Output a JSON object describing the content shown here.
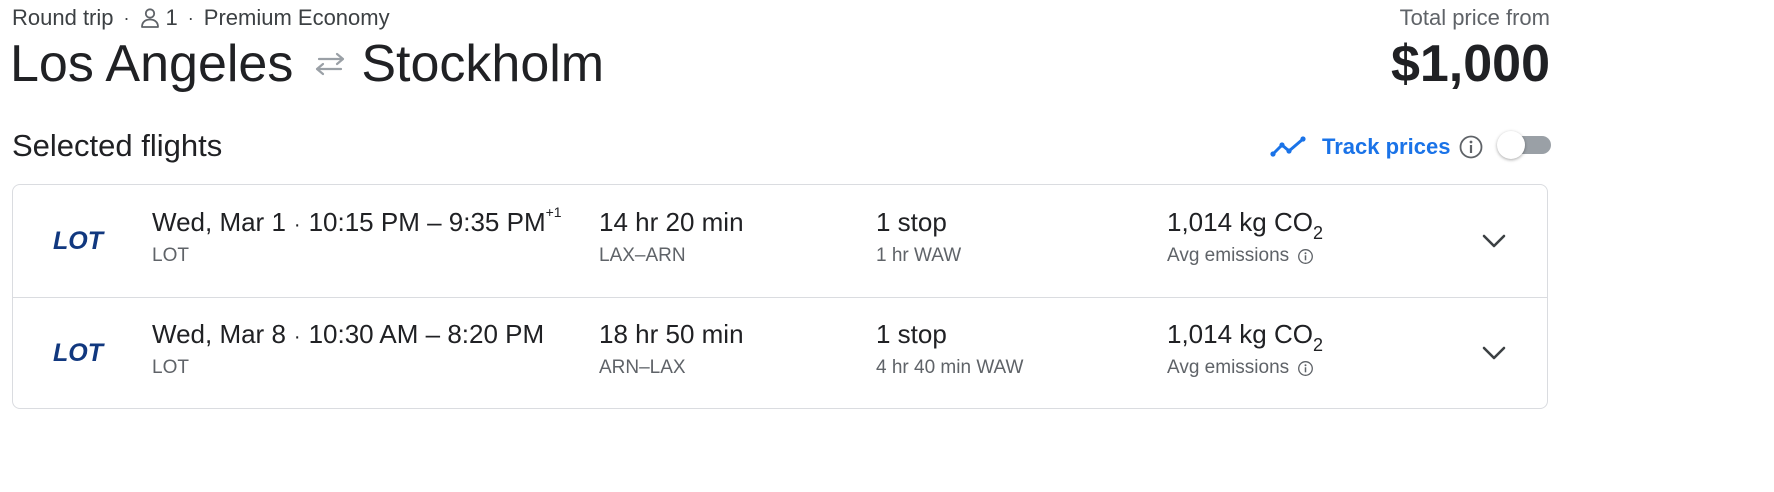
{
  "trip": {
    "type": "Round trip",
    "passengers": "1",
    "cabin": "Premium Economy",
    "separator": "·"
  },
  "route": {
    "origin": "Los Angeles",
    "destination": "Stockholm"
  },
  "price": {
    "label": "Total price from",
    "amount": "$1,000"
  },
  "section": {
    "title": "Selected flights"
  },
  "track_prices": {
    "label": "Track prices",
    "enabled": false,
    "accent_color": "#1a73e8"
  },
  "flights": [
    {
      "date": "Wed, Mar 1",
      "dot": "·",
      "time_range": "10:15 PM – 9:35 PM",
      "day_offset": "+1",
      "airline": "LOT",
      "logo_text": "LOT",
      "duration": "14 hr 20 min",
      "airports": "LAX–ARN",
      "stops": "1 stop",
      "layover": "1 hr WAW",
      "emissions_value": "1,014 kg CO",
      "emissions_sub": "2",
      "emissions_label": "Avg emissions"
    },
    {
      "date": "Wed, Mar 8",
      "dot": "·",
      "time_range": "10:30 AM – 8:20 PM",
      "day_offset": "",
      "airline": "LOT",
      "logo_text": "LOT",
      "duration": "18 hr 50 min",
      "airports": "ARN–LAX",
      "stops": "1 stop",
      "layover": "4 hr 40 min WAW",
      "emissions_value": "1,014 kg CO",
      "emissions_sub": "2",
      "emissions_label": "Avg emissions"
    }
  ],
  "icons": {
    "person": "person-icon",
    "swap": "swap-arrows-icon",
    "trend": "trending-line-icon",
    "info": "info-icon",
    "expand": "chevron-down-icon",
    "airline_logo": "lot-logo"
  },
  "colors": {
    "brand_blue": "#1a73e8",
    "lot_navy": "#11387f",
    "text_primary": "#202124",
    "text_secondary": "#5f6368",
    "border": "#dadce0"
  }
}
